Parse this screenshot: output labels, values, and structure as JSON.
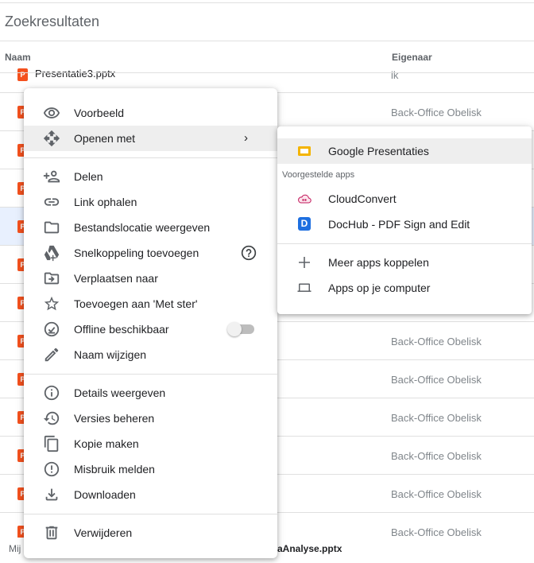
{
  "page": {
    "results_title": "Zoekresultaten",
    "col_name": "Naam",
    "col_owner": "Eigenaar"
  },
  "files": [
    {
      "name": "Presentatie3.pptx",
      "owner": "ik"
    },
    {
      "name": "",
      "owner": "Back-Office Obelisk"
    },
    {
      "name": "",
      "owner": ""
    },
    {
      "name": "",
      "owner": ""
    },
    {
      "name": "",
      "owner": ""
    },
    {
      "name": "",
      "owner": ""
    },
    {
      "name": "",
      "owner": ""
    },
    {
      "name": "",
      "owner": "Back-Office Obelisk"
    },
    {
      "name": "",
      "owner": "Back-Office Obelisk"
    },
    {
      "name": "",
      "owner": "Back-Office Obelisk"
    },
    {
      "name": "",
      "owner": "Back-Office Obelisk"
    },
    {
      "name": "",
      "owner": "Back-Office Obelisk"
    },
    {
      "name": "",
      "owner": "Back-Office Obelisk"
    }
  ],
  "file_icon_letter": "P",
  "bottom": {
    "left_text": "Mij",
    "file_text": "aAnalyse.pptx"
  },
  "menu": {
    "items": [
      {
        "label": "Voorbeeld",
        "icon": "eye-icon"
      },
      {
        "label": "Openen met",
        "icon": "move-arrows-icon",
        "arrow": "›"
      },
      {
        "label": "Delen",
        "icon": "person-add-icon"
      },
      {
        "label": "Link ophalen",
        "icon": "link-icon"
      },
      {
        "label": "Bestandslocatie weergeven",
        "icon": "folder-icon"
      },
      {
        "label": "Snelkoppeling toevoegen",
        "icon": "drive-shortcut-icon"
      },
      {
        "label": "Verplaatsen naar",
        "icon": "folder-move-icon"
      },
      {
        "label": "Toevoegen aan 'Met ster'",
        "icon": "star-icon"
      },
      {
        "label": "Offline beschikbaar",
        "icon": "offline-check-icon"
      },
      {
        "label": "Naam wijzigen",
        "icon": "pencil-icon"
      },
      {
        "label": "Details weergeven",
        "icon": "info-icon"
      },
      {
        "label": "Versies beheren",
        "icon": "history-icon"
      },
      {
        "label": "Kopie maken",
        "icon": "copy-icon"
      },
      {
        "label": "Misbruik melden",
        "icon": "report-icon"
      },
      {
        "label": "Downloaden",
        "icon": "download-icon"
      },
      {
        "label": "Verwijderen",
        "icon": "trash-icon"
      }
    ]
  },
  "submenu": {
    "caption": "Voorgestelde apps",
    "items": [
      {
        "label": "Google Presentaties",
        "icon": "google-slides-icon"
      },
      {
        "label": "CloudConvert",
        "icon": "cloudconvert-icon"
      },
      {
        "label": "DocHub - PDF Sign and Edit",
        "icon": "dochub-icon",
        "badge": "D"
      },
      {
        "label": "Meer apps koppelen",
        "icon": "plus-icon"
      },
      {
        "label": "Apps op je computer",
        "icon": "laptop-icon"
      }
    ]
  },
  "colors": {
    "file_icon": "#f4511e",
    "slides_yellow": "#f4b400",
    "dochub_blue": "#1e6fe0",
    "menu_highlight": "#eeeeee",
    "selected_row": "#e8f0fe"
  }
}
